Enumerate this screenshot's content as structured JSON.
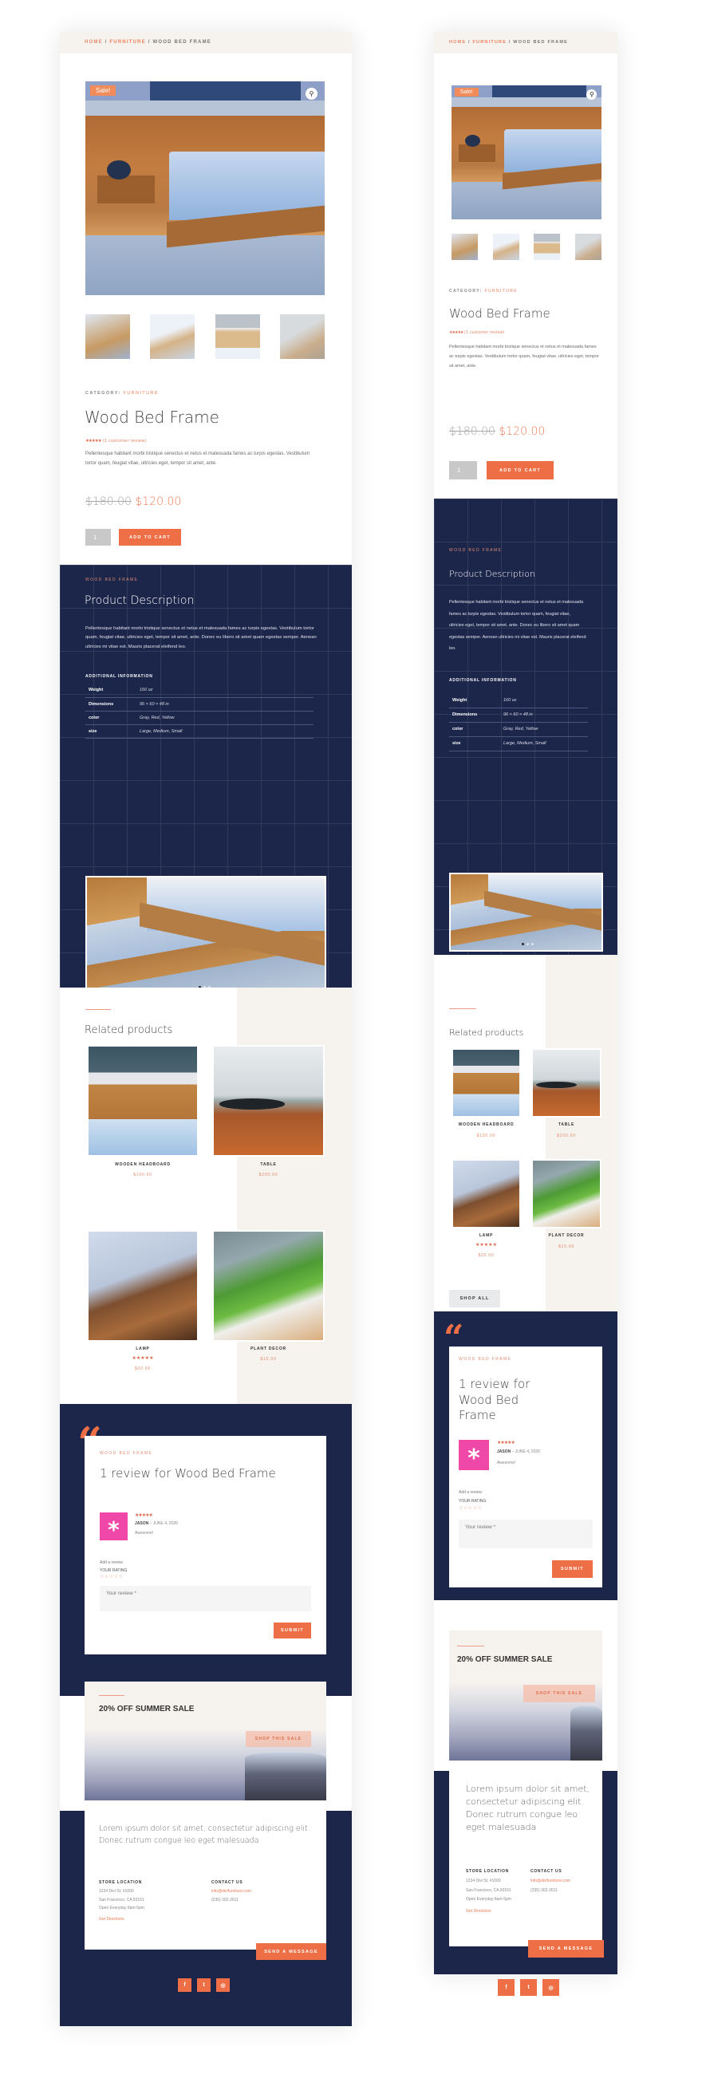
{
  "colors": {
    "accent": "#ee6f45",
    "navy": "#1c264a",
    "cream": "#f6f2ee",
    "pink_avatar": "#f048a8"
  },
  "breadcrumb": {
    "home": "HOME",
    "sep": " / ",
    "category": "FURNITURE",
    "current": "WOOD BED FRAME"
  },
  "gallery": {
    "sale_badge": "Sale!",
    "zoom_icon": "magnifier-icon",
    "thumbnail_count": 4
  },
  "product": {
    "category_label": "CATEGORY:",
    "category": "FURNITURE",
    "title": "Wood Bed Frame",
    "rating_stars": "★★★★★",
    "rating": 5,
    "review_link": "(1 customer review)",
    "short_description": "Pellentesque habitant morbi tristique senectus et netus et malesuada fames ac turpis egestas. Vestibulum tortor quam, feugiat vitae, ultricies eget, tempor sit amet, ante.",
    "old_price": "$180.00",
    "price": "$120.00",
    "quantity": "1",
    "add_to_cart": "ADD TO CART"
  },
  "description": {
    "kicker": "WOOD BED FRAME",
    "title": "Product Description",
    "text": "Pellentesque habitant morbi tristique senectus et netus et malesuada fames ac turpis egestas. Vestibulum tortor quam, feugiat vitae, ultricies eget, tempor sit amet, ante. Donec eu libero sit amet quam egestas semper. Aenean ultricies mi vitae est. Mauris placerat eleifend leo.",
    "additional_heading": "ADDITIONAL INFORMATION",
    "attributes": [
      {
        "label": "Weight",
        "value": "160 oz"
      },
      {
        "label": "Dimensions",
        "value": "96 × 60 × 48 in"
      },
      {
        "label": "color",
        "value": "Gray, Red, Yellow"
      },
      {
        "label": "size",
        "value": "Large, Medium, Small"
      }
    ],
    "slider": {
      "slide_count": 3,
      "active_slide": 1
    }
  },
  "related": {
    "title": "Related products",
    "products": [
      {
        "name": "WOODEN HEADBOARD",
        "price": "$150.00",
        "stars": ""
      },
      {
        "name": "TABLE",
        "price": "$200.00",
        "stars": ""
      },
      {
        "name": "LAMP",
        "price": "$20.00",
        "stars": "★★★★★"
      },
      {
        "name": "PLANT DECOR",
        "price": "$15.00",
        "stars": ""
      }
    ],
    "shop_all": "SHOP ALL"
  },
  "reviews": {
    "quote_glyph": "“",
    "kicker": "WOOD BED FRAME",
    "title": "1 review for Wood Bed Frame",
    "items": [
      {
        "avatar_glyph": "*",
        "stars": "★★★★★",
        "author": "JASON",
        "date": " – JUNE 4, 2020",
        "text": "Awesome!"
      }
    ],
    "add_review": "Add a review",
    "your_rating": "YOUR RATING",
    "empty_stars": "☆☆☆☆☆",
    "review_placeholder": "Your review *",
    "submit": "SUBMIT"
  },
  "sale_banner": {
    "title": "20% OFF SUMMER SALE",
    "button": "SHOP THIS SALE"
  },
  "footer": {
    "lorem": "Lorem ipsum dolor sit amet, consectetur adipiscing elit. Donec rutrum congue leo eget malesuada",
    "store_heading": "STORE LOCATION",
    "address1": "1234 Divi St. #1000",
    "address2": "San Francisco, CA 93151",
    "hours": "Open Everyday 8am-5pm",
    "directions": "Get Directions",
    "contact_heading": "CONTACT US",
    "email": "info@divifurniture.com",
    "phone": "(235) 302-2611",
    "send_message": "SEND A MESSAGE",
    "social": [
      {
        "name": "facebook",
        "glyph": "f"
      },
      {
        "name": "twitter",
        "glyph": "t"
      },
      {
        "name": "instagram",
        "glyph": "◎"
      }
    ]
  }
}
